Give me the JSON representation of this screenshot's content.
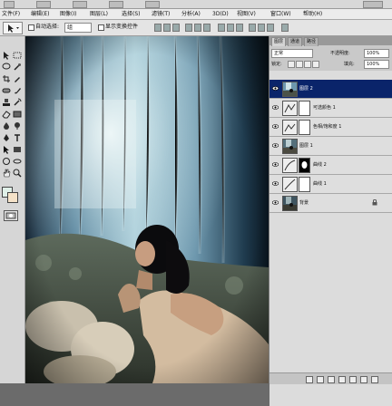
{
  "menubar": {
    "items": [
      {
        "label": "文件(F)"
      },
      {
        "label": "编辑(E)"
      },
      {
        "label": "图像(I)"
      },
      {
        "label": "图层(L)"
      },
      {
        "label": "选择(S)"
      },
      {
        "label": "滤镜(T)"
      },
      {
        "label": "分析(A)"
      },
      {
        "label": "3D(D)"
      },
      {
        "label": "视图(V)"
      },
      {
        "label": "窗口(W)"
      },
      {
        "label": "帮助(H)"
      }
    ]
  },
  "options_bar": {
    "auto_select_label": "自动选择:",
    "auto_select_value": "组",
    "show_transform_label": "显示变换控件"
  },
  "layers_panel": {
    "tabs": [
      {
        "label": "图层"
      },
      {
        "label": "通道"
      },
      {
        "label": "路径"
      }
    ],
    "blend_mode": "正常",
    "opacity_label": "不透明度:",
    "opacity_value": "100%",
    "lock_label": "锁定:",
    "fill_label": "填充:",
    "fill_value": "100%",
    "layers": [
      {
        "name": "图层 2",
        "selected": true,
        "thumb": "photo",
        "mask": false
      },
      {
        "name": "可选颜色 1",
        "selected": false,
        "thumb": "adjust",
        "mask": true
      },
      {
        "name": "色相/饱和度 1",
        "selected": false,
        "thumb": "adjust",
        "mask": true
      },
      {
        "name": "图层 1",
        "selected": false,
        "thumb": "photo",
        "mask": false
      },
      {
        "name": "曲线 2",
        "selected": false,
        "thumb": "adjust",
        "mask": true,
        "mask_black": true
      },
      {
        "name": "曲线 1",
        "selected": false,
        "thumb": "adjust",
        "mask": true
      },
      {
        "name": "背景",
        "selected": false,
        "thumb": "photo",
        "mask": false,
        "locked": true
      }
    ]
  },
  "colors": {
    "selected_layer_bg": "#0a246a",
    "panel_bg": "#c9c9c9"
  }
}
